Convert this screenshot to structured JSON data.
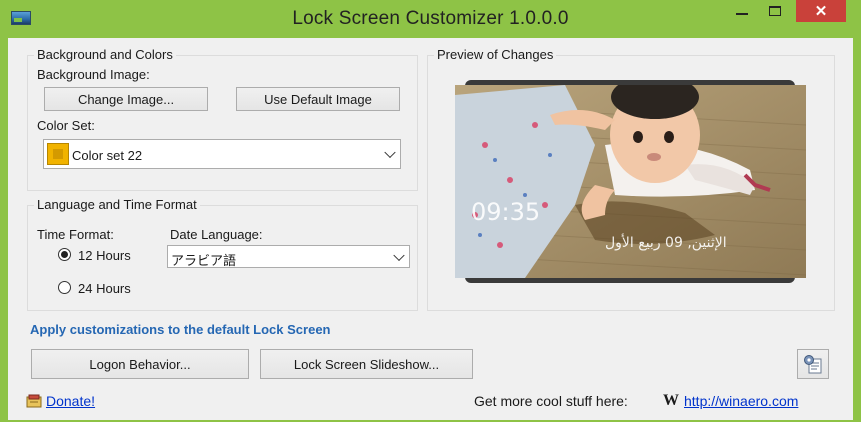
{
  "window": {
    "title": "Lock Screen Customizer 1.0.0.0"
  },
  "titlebar": {
    "minimize": "",
    "maximize": "",
    "close": "✕"
  },
  "background_group": {
    "title": "Background and Colors",
    "background_image_label": "Background Image:",
    "change_image_button": "Change Image...",
    "use_default_button": "Use Default Image",
    "color_set_label": "Color Set:",
    "color_set_value": "Color set 22",
    "swatch_color": "#f1b300"
  },
  "language_group": {
    "title": "Language and Time Format",
    "time_format_label": "Time Format:",
    "option_12": "12 Hours",
    "option_24": "24 Hours",
    "selected_time_format": "12 Hours",
    "date_language_label": "Date Language:",
    "date_language_value": "アラビア語"
  },
  "preview_group": {
    "title": "Preview of Changes",
    "time": "09:35",
    "date": "الإثنين, 09 ربيع الأول"
  },
  "apply_link": "Apply customizations to the default Lock Screen",
  "actions": {
    "logon_behavior": "Logon Behavior...",
    "slideshow": "Lock Screen Slideshow..."
  },
  "footer": {
    "donate": "Donate!",
    "more_text": "Get more cool stuff here:",
    "winaero_logo": "W",
    "url": "http://winaero.com"
  },
  "colors": {
    "frame": "#8ec346",
    "close_button": "#c9413a",
    "apply_link": "#2567b3",
    "hyperlink": "#0033cc"
  }
}
